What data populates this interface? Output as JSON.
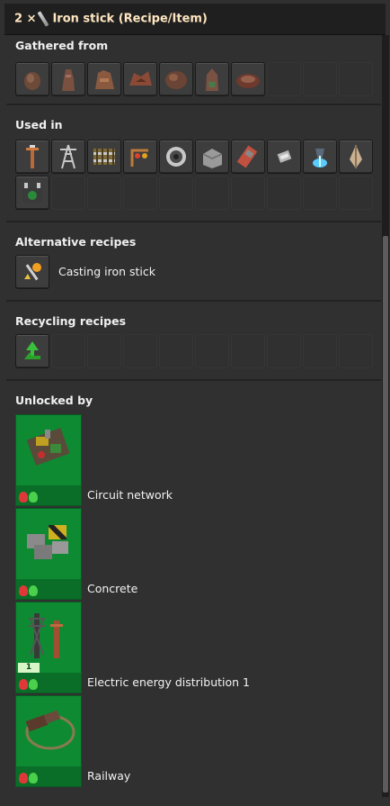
{
  "titlebar": {
    "count": "2 ×",
    "title": "Iron stick (Recipe/Item)"
  },
  "gathered": {
    "title": "Gathered from",
    "items": [
      "rock-icon",
      "huge-rock-icon",
      "big-sand-rock-icon",
      "red-rock-icon",
      "brown-rock-icon",
      "vulcanus-rock-icon",
      "flat-rock-icon"
    ]
  },
  "used_in": {
    "title": "Used in",
    "items": [
      "medium-electric-pole-icon",
      "big-electric-pole-icon",
      "rail-icon",
      "rail-signal-icon",
      "programmable-speaker-icon",
      "concrete-icon",
      "rocket-silo-part-icon",
      "small-lamp-icon",
      "beacon-light-icon",
      "spike-icon",
      "radar-combinator-icon"
    ]
  },
  "alternative": {
    "title": "Alternative recipes",
    "items": [
      {
        "icon": "casting-icon",
        "label": "Casting iron stick"
      }
    ]
  },
  "recycling": {
    "title": "Recycling recipes",
    "items": [
      "recycling-icon"
    ]
  },
  "unlocked": {
    "title": "Unlocked by",
    "techs": [
      {
        "label": "Circuit network",
        "icon": "circuit-network-icon",
        "level": ""
      },
      {
        "label": "Concrete",
        "icon": "concrete-tech-icon",
        "level": ""
      },
      {
        "label": "Electric energy distribution 1",
        "icon": "electric-pole-tech-icon",
        "level": "1"
      },
      {
        "label": "Railway",
        "icon": "railway-icon",
        "level": ""
      }
    ]
  },
  "colors": {
    "tech_green": "#0d8a32",
    "title_text": "#ffe6c0",
    "panel_bg": "#313031"
  }
}
